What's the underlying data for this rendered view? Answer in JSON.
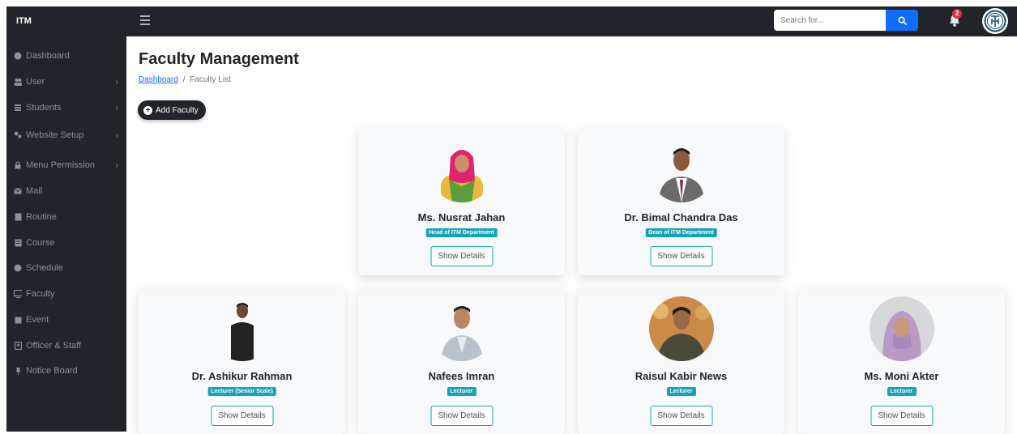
{
  "app": {
    "brand": "ITM"
  },
  "search": {
    "placeholder": "Search for..."
  },
  "notifications": {
    "count": "2"
  },
  "sidebar": {
    "items": [
      {
        "label": "Dashboard",
        "has_submenu": false
      },
      {
        "label": "User",
        "has_submenu": true
      },
      {
        "label": "Students",
        "has_submenu": true
      },
      {
        "label": "Website Setup",
        "has_submenu": true
      },
      {
        "label": "Menu Permission",
        "has_submenu": true
      },
      {
        "label": "Mail",
        "has_submenu": false
      },
      {
        "label": "Routine",
        "has_submenu": false
      },
      {
        "label": "Course",
        "has_submenu": false
      },
      {
        "label": "Schedule",
        "has_submenu": false
      },
      {
        "label": "Faculty",
        "has_submenu": false
      },
      {
        "label": "Event",
        "has_submenu": false
      },
      {
        "label": "Officer & Staff",
        "has_submenu": false
      },
      {
        "label": "Notice Board",
        "has_submenu": false
      }
    ]
  },
  "main": {
    "title": "Faculty Management",
    "breadcrumb": {
      "link": "Dashboard",
      "separator": "/",
      "current": "Faculty List"
    },
    "add_button": "Add Faculty",
    "faculty": [
      {
        "name": "Ms. Nusrat Jahan",
        "role": "Head of ITM Department",
        "button": "Show Details"
      },
      {
        "name": "Dr. Bimal Chandra Das",
        "role": "Dean of ITM Department",
        "button": "Show Details"
      },
      {
        "name": "Dr. Ashikur Rahman",
        "role": "Lecturer (Senior Scale)",
        "button": "Show Details"
      },
      {
        "name": "Nafees Imran",
        "role": "Lecturer",
        "button": "Show Details"
      },
      {
        "name": "Raisul Kabir News",
        "role": "Lecturer",
        "button": "Show Details"
      },
      {
        "name": "Ms. Moni Akter",
        "role": "Lecturer",
        "button": "Show Details"
      }
    ]
  },
  "colors": {
    "sidebar_bg": "#212529",
    "badge": "#17a2b8",
    "primary": "#0d6efd",
    "notification": "#dc3545"
  }
}
